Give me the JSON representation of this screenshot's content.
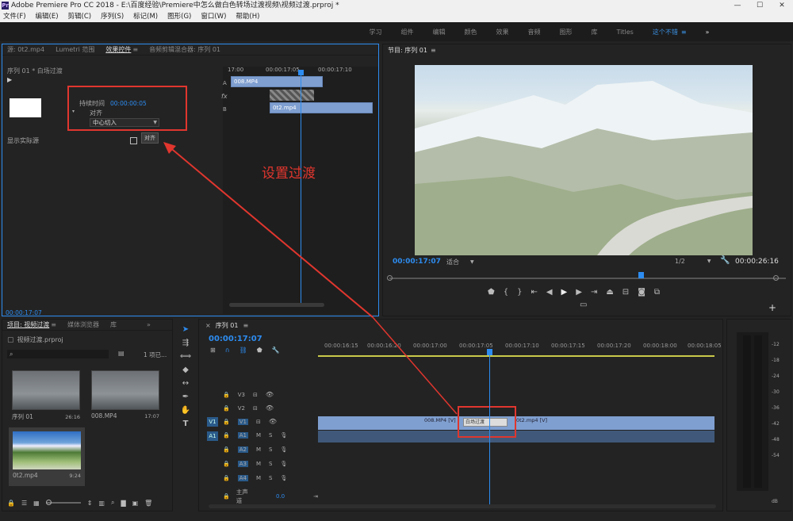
{
  "app": {
    "title": "Adobe Premiere Pro CC 2018 - E:\\百度经验\\Premiere中怎么做白色转场过渡视频\\视频过渡.prproj *",
    "min": "—",
    "max": "☐",
    "close": "✕"
  },
  "menu": [
    "文件(F)",
    "编辑(E)",
    "剪辑(C)",
    "序列(S)",
    "标记(M)",
    "图形(G)",
    "窗口(W)",
    "帮助(H)"
  ],
  "workspaces": [
    "学习",
    "组件",
    "编辑",
    "颜色",
    "效果",
    "音频",
    "图形",
    "库",
    "Titles",
    "这个不错"
  ],
  "workspace_menu": "≡",
  "workspace_more": "»",
  "effects_panel": {
    "tabs": [
      "源: 0t2.mp4",
      "Lumetri 范围",
      "效果控件",
      "音频剪辑混合器: 序列 01"
    ],
    "tabs_menu": "≡",
    "sequence": "序列 01 * 白场过渡",
    "duration_label": "持续时间",
    "duration_value": "00:00:00:05",
    "align_label": "对齐",
    "align_value": "中心切入",
    "show_source_label": "显示实际源",
    "align_button": "对齐",
    "timecode": "00:00:17:07",
    "mini_ruler": [
      "17:00",
      "00:00:17:05",
      "00:00:17:10"
    ],
    "clip_a": "008.MP4",
    "clip_b": "0t2.mp4",
    "label_a": "A",
    "label_fx": "fx",
    "label_b": "B"
  },
  "annotation": "设置过渡",
  "program": {
    "title": "节目: 序列 01",
    "menu": "≡",
    "timecode": "00:00:17:07",
    "fit": "适合",
    "resolution": "1/2",
    "duration": "00:00:26:16"
  },
  "project": {
    "tabs": [
      "项目: 视频过渡",
      "媒体浏览器",
      "库"
    ],
    "tabs_menu": "≡",
    "tabs_more": "»",
    "file": "视频过渡.prproj",
    "selection": "1 项已...",
    "items": [
      {
        "name": "序列 01",
        "duration": "26:16"
      },
      {
        "name": "008.MP4",
        "duration": "17:07"
      },
      {
        "name": "0t2.mp4",
        "duration": "9:24"
      }
    ]
  },
  "timeline": {
    "title": "序列 01",
    "close": "×",
    "menu": "≡",
    "timecode": "00:00:17:07",
    "ruler": [
      "00:00:16:15",
      "00:00:16:20",
      "00:00:17:00",
      "00:00:17:05",
      "00:00:17:10",
      "00:00:17:15",
      "00:00:17:20",
      "00:00:18:00",
      "00:00:18:05"
    ],
    "video_tracks": [
      "V3",
      "V2",
      "V1"
    ],
    "audio_tracks": [
      "A1",
      "A2",
      "A3",
      "A4"
    ],
    "src_v": "V1",
    "src_a": "A1",
    "master": "主声道",
    "master_value": "0.0",
    "clip_008": "008.MP4 [V]",
    "clip_0t2": "0t2.mp4 [V]",
    "transition": "白场过渡",
    "m": "M",
    "s": "S"
  },
  "meter_labels": [
    "-12",
    "-18",
    "-24",
    "-30",
    "-36",
    "-42",
    "-48",
    "-54"
  ],
  "meter_db": "dB"
}
